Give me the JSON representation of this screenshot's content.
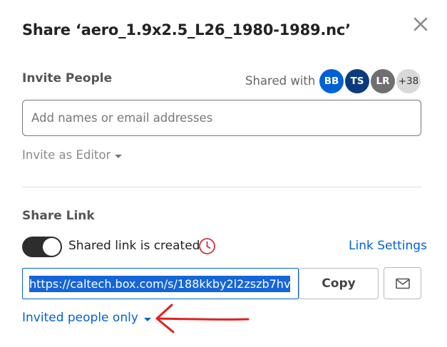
{
  "dialog": {
    "title": "Share ‘aero_1.9x2.5_L26_1980-1989.nc’"
  },
  "invite": {
    "section_label": "Invite People",
    "shared_with_label": "Shared with",
    "avatars": [
      {
        "initials": "BB",
        "color": "#0061d5"
      },
      {
        "initials": "TS",
        "color": "#0b3a7e"
      },
      {
        "initials": "LR",
        "color": "#6f6f6f"
      }
    ],
    "more_count": "+38",
    "more_color": "#d9d9d9",
    "input_placeholder": "Add names or email addresses",
    "invite_as": "Invite as Editor"
  },
  "share_link": {
    "section_label": "Share Link",
    "toggle_on": true,
    "status_text": "Shared link is created",
    "link_settings": "Link Settings",
    "url": "https://caltech.box.com/s/188kkby2l2zszb7hv",
    "copy_label": "Copy",
    "access": "Invited people only"
  },
  "colors": {
    "accent": "#0061d5",
    "annotation": "#e02020",
    "clock": "#d0353f"
  }
}
